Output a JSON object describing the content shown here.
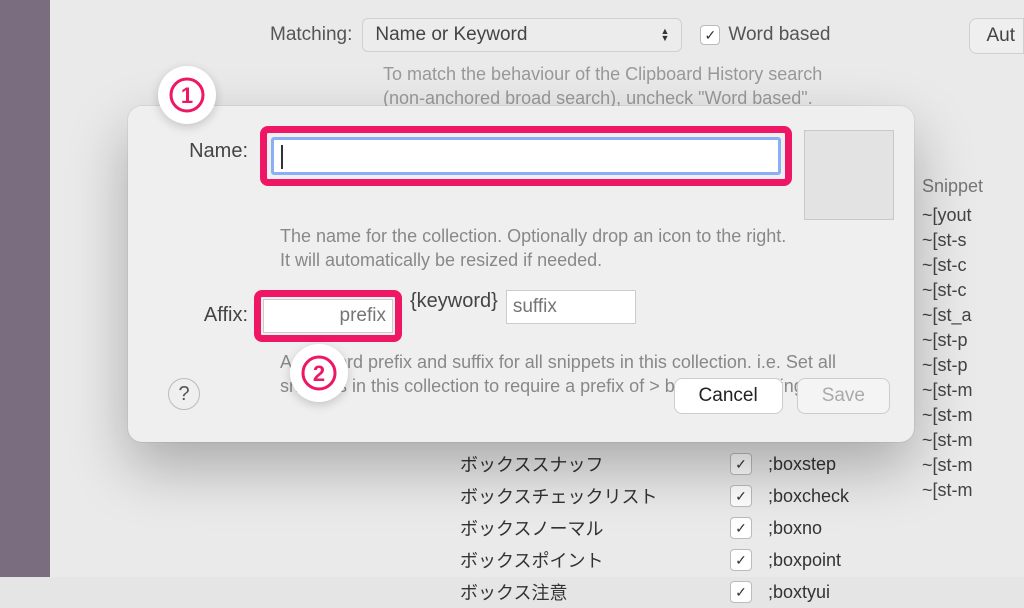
{
  "toolbar": {
    "matching_label": "Matching:",
    "matching_value": "Name or Keyword",
    "word_based_label": "Word based",
    "auto_button": "Aut",
    "hint_line1": "To match the behaviour of the Clipboard History search",
    "hint_line2": "(non-anchored broad search), uncheck \"Word based\"."
  },
  "dialog": {
    "name_label": "Name:",
    "name_value": "",
    "name_desc": "The name for the collection. Optionally drop an icon to the right. It will automatically be resized if needed.",
    "affix_label": "Affix:",
    "prefix_placeholder": "prefix",
    "keyword_text": "{keyword}",
    "suffix_placeholder": "suffix",
    "affix_desc": "A keyword prefix and suffix for all snippets in this collection. i.e. Set all snippets in this collection to require a prefix of > before expanding.",
    "help": "?",
    "cancel": "Cancel",
    "save": "Save"
  },
  "annotations": {
    "badge1": "1",
    "badge2": "2"
  },
  "right_list": {
    "header": "Snippet",
    "items": [
      "~[yout",
      "~[st-s",
      "~[st-c",
      "~[st-c",
      "~[st_a",
      "~[st-p",
      "~[st-p",
      "~[st-m",
      "~[st-m",
      "~[st-m",
      "~[st-m",
      "~[st-m"
    ]
  },
  "bg_snippets": [
    {
      "name": "ボックススナッフ",
      "keyword": ";boxstep"
    },
    {
      "name": "ボックスチェックリスト",
      "keyword": ";boxcheck"
    },
    {
      "name": "ボックスノーマル",
      "keyword": ";boxno"
    },
    {
      "name": "ボックスポイント",
      "keyword": ";boxpoint"
    },
    {
      "name": "ボックス注意",
      "keyword": ";boxtyui"
    }
  ]
}
